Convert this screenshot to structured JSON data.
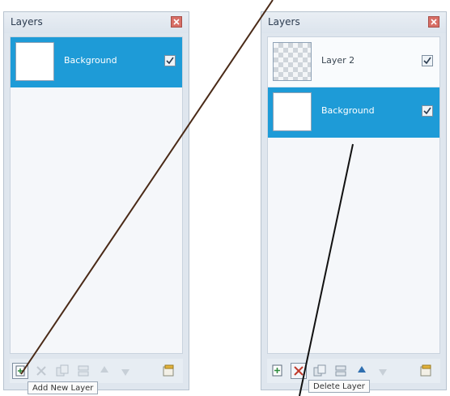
{
  "left_panel": {
    "title": "Layers",
    "layers": [
      {
        "name": "Background",
        "selected": true,
        "visible": true
      }
    ],
    "tooltip": "Add New Layer"
  },
  "right_panel": {
    "title": "Layers",
    "layers": [
      {
        "name": "Layer 2",
        "selected": false,
        "visible": true
      },
      {
        "name": "Background",
        "selected": true,
        "visible": true
      }
    ],
    "tooltip": "Delete Layer"
  },
  "colors": {
    "selection": "#1e9bd7",
    "panel": "#dfe6ee",
    "close": "#d86f66",
    "annotation_left": "#4a2a17",
    "annotation_right": "#111111"
  },
  "icons": [
    "close-icon",
    "checkmark-icon",
    "add-layer-icon",
    "delete-layer-icon",
    "duplicate-layer-icon",
    "merge-layer-icon",
    "move-layer-up-icon",
    "move-layer-down-icon",
    "layer-properties-icon"
  ]
}
